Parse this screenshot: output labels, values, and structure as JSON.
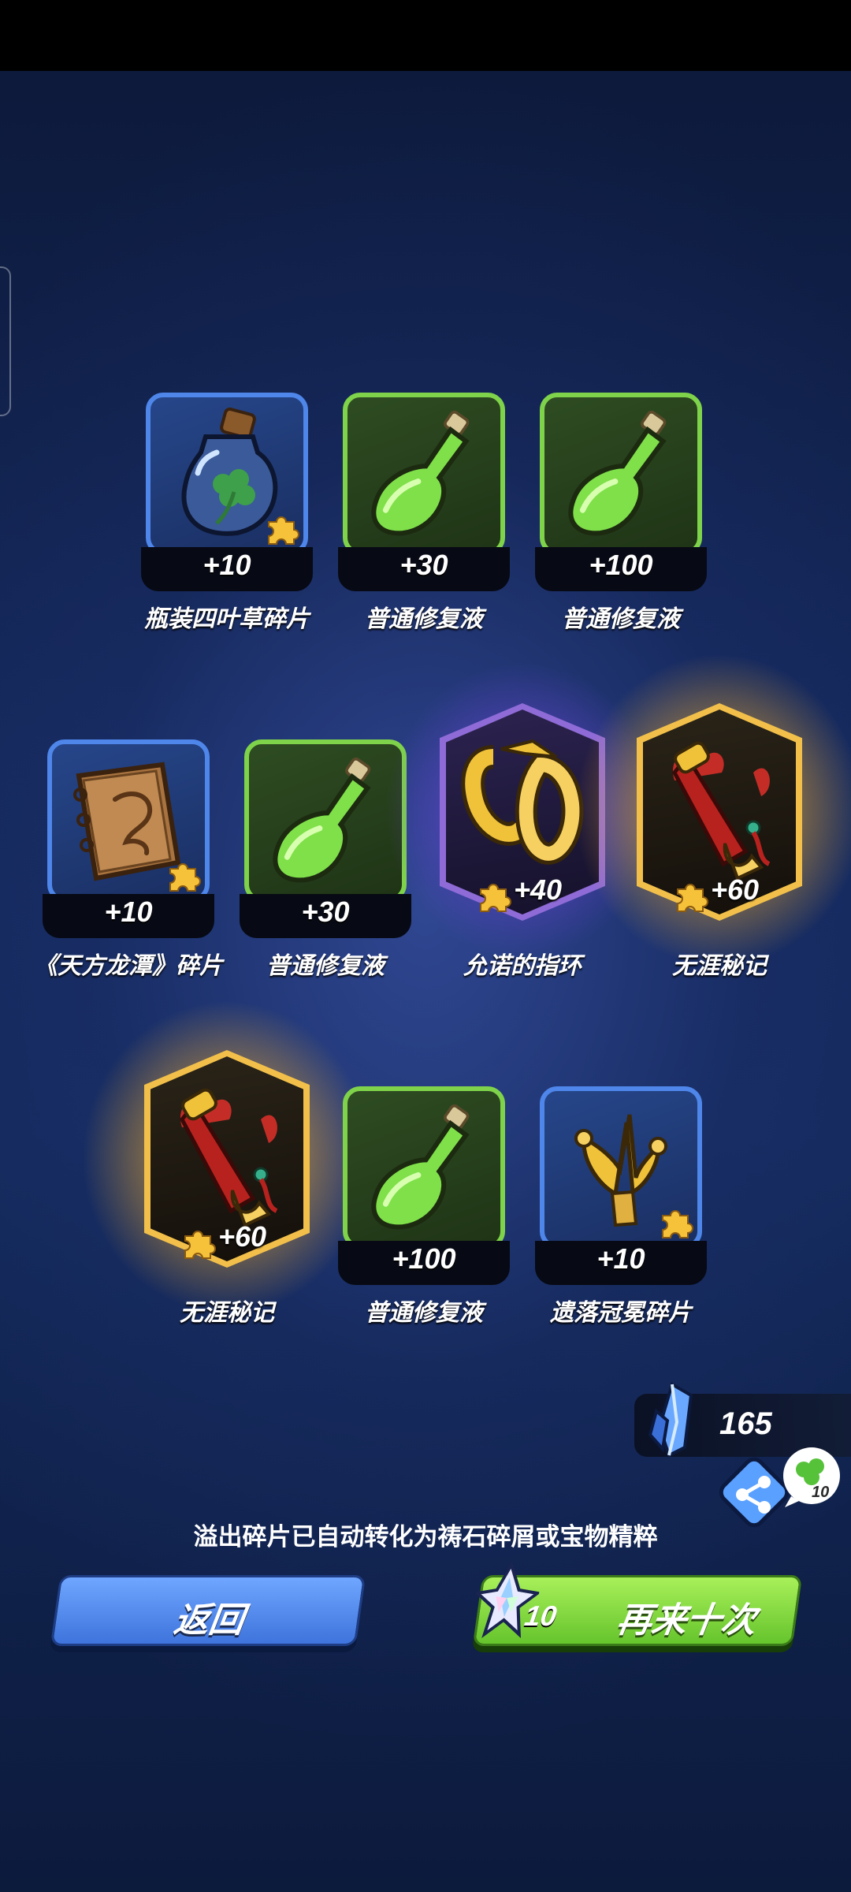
{
  "rewards": [
    {
      "count": "+10",
      "name": "瓶装四叶草碎片",
      "rarity": "blue",
      "icon": "four-leaf-clover-bottle-icon",
      "fragment": true
    },
    {
      "count": "+30",
      "name": "普通修复液",
      "rarity": "green",
      "icon": "potion-flask-icon",
      "fragment": false
    },
    {
      "count": "+100",
      "name": "普通修复液",
      "rarity": "green",
      "icon": "potion-flask-icon",
      "fragment": false
    },
    {
      "count": "+10",
      "name": "《天方龙潭》碎片",
      "rarity": "blue",
      "icon": "dragon-book-icon",
      "fragment": true
    },
    {
      "count": "+30",
      "name": "普通修复液",
      "rarity": "green",
      "icon": "potion-flask-icon",
      "fragment": false
    },
    {
      "count": "+40",
      "name": "允诺的指环",
      "rarity": "purple",
      "icon": "golden-ring-icon",
      "fragment": true
    },
    {
      "count": "+60",
      "name": "无涯秘记",
      "rarity": "gold",
      "icon": "red-scroll-icon",
      "fragment": true
    },
    {
      "count": "+60",
      "name": "无涯秘记",
      "rarity": "gold",
      "icon": "red-scroll-icon",
      "fragment": true
    },
    {
      "count": "+100",
      "name": "普通修复液",
      "rarity": "green",
      "icon": "potion-flask-icon",
      "fragment": false
    },
    {
      "count": "+10",
      "name": "遗落冠冕碎片",
      "rarity": "blue",
      "icon": "golden-crown-icon",
      "fragment": true
    }
  ],
  "crystal_count": "165",
  "clover_count": "10",
  "notice": "溢出碎片已自动转化为祷石碎屑或宝物精粹",
  "buttons": {
    "back": "返回",
    "again": "再来十次",
    "again_cost": "10"
  },
  "colors": {
    "blue_frame": "#4e86ea",
    "green_frame": "#7fd34a",
    "purple_frame": "#8e6bd6",
    "gold_frame": "#f2c04a"
  }
}
